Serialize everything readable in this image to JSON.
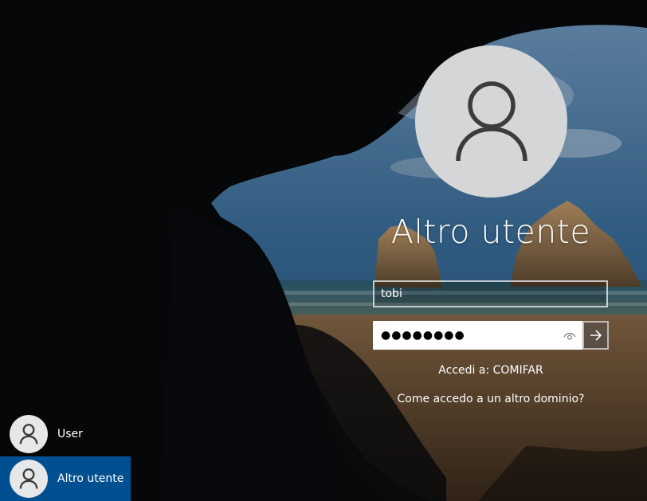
{
  "login": {
    "title": "Altro utente",
    "username_value": "tobi",
    "password_mask": "●●●●●●●●",
    "domain_label": "Accedi a: COMIFAR",
    "other_domain_link": "Come accedo a un altro dominio?"
  },
  "user_list": {
    "items": [
      {
        "name": "User",
        "selected": false
      },
      {
        "name": "Altro utente",
        "selected": true
      }
    ]
  },
  "colors": {
    "selection": "#004f91",
    "avatar_bg": "#d4d6d8"
  },
  "icons": {
    "user": "user-silhouette-icon",
    "reveal": "eye-icon",
    "submit": "arrow-right-icon"
  }
}
